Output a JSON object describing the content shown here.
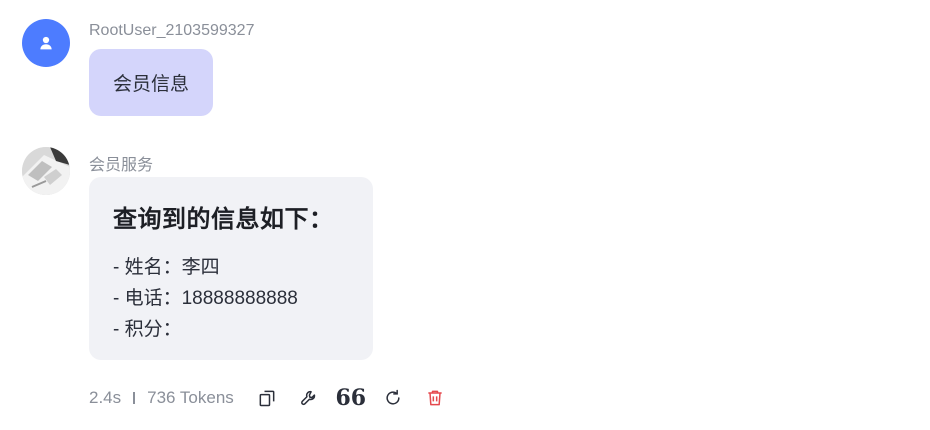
{
  "messages": [
    {
      "role": "user",
      "sender": "RootUser_2103599327",
      "text": "会员信息"
    },
    {
      "role": "bot",
      "sender": "会员服务",
      "heading": "查询到的信息如下：",
      "lines": [
        "- 姓名：李四",
        "- 电话：18888888888",
        "- 积分："
      ]
    }
  ],
  "meta": {
    "duration": "2.4s",
    "tokens": "736 Tokens"
  },
  "toolbar": {
    "icons": [
      "copy-icon",
      "tool-icon",
      "quote-icon",
      "refresh-icon",
      "trash-icon"
    ],
    "quote_glyph": "66"
  },
  "colors": {
    "user_avatar": "#4d7cff",
    "user_bubble": "#d4d5fb",
    "bot_bubble": "#f1f2f6",
    "danger": "#e5484d"
  }
}
